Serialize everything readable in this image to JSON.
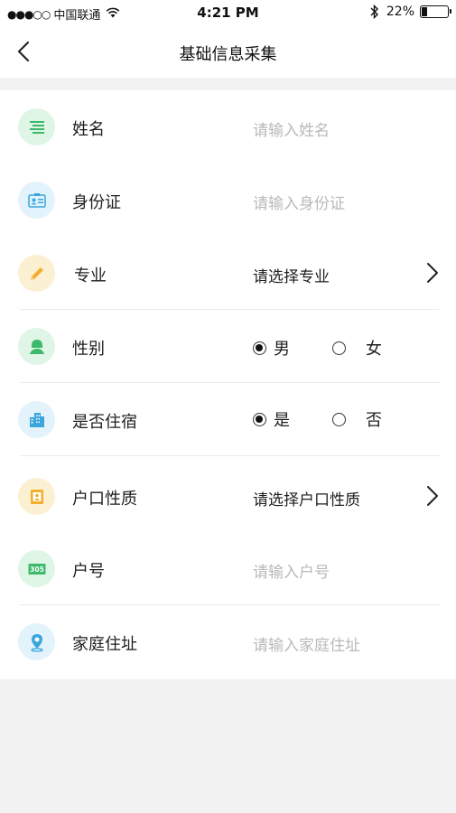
{
  "status_bar": {
    "carrier": "中国联通",
    "time": "4:21 PM",
    "battery": "22%",
    "battery_level": 0.22
  },
  "nav": {
    "title": "基础信息采集"
  },
  "form": {
    "name": {
      "label": "姓名",
      "placeholder": "请输入姓名",
      "icon": "list-icon"
    },
    "id_card": {
      "label": "身份证",
      "placeholder": "请输入身份证",
      "icon": "id-card-icon"
    },
    "major": {
      "label": "专业",
      "value": "请选择专业",
      "icon": "pencil-icon"
    },
    "gender": {
      "label": "性别",
      "options": [
        "男",
        "女"
      ],
      "selected": "男",
      "icon": "person-icon"
    },
    "boarding": {
      "label": "是否住宿",
      "options": [
        "是",
        "否"
      ],
      "selected": "是",
      "icon": "building-icon"
    },
    "household_type": {
      "label": "户口性质",
      "value": "请选择户口性质",
      "icon": "contact-book-icon"
    },
    "household_no": {
      "label": "户号",
      "placeholder": "请输入户号",
      "icon": "room-number-icon",
      "icon_text": "305"
    },
    "address": {
      "label": "家庭住址",
      "placeholder": "请输入家庭住址",
      "icon": "location-pin-icon"
    }
  },
  "colors": {
    "green_bg": "#dff5e6",
    "green": "#3cb96a",
    "blue_bg": "#e3f3fb",
    "blue": "#3aa6dc",
    "yellow_bg": "#fbf0d2",
    "yellow": "#f2ae2c"
  }
}
